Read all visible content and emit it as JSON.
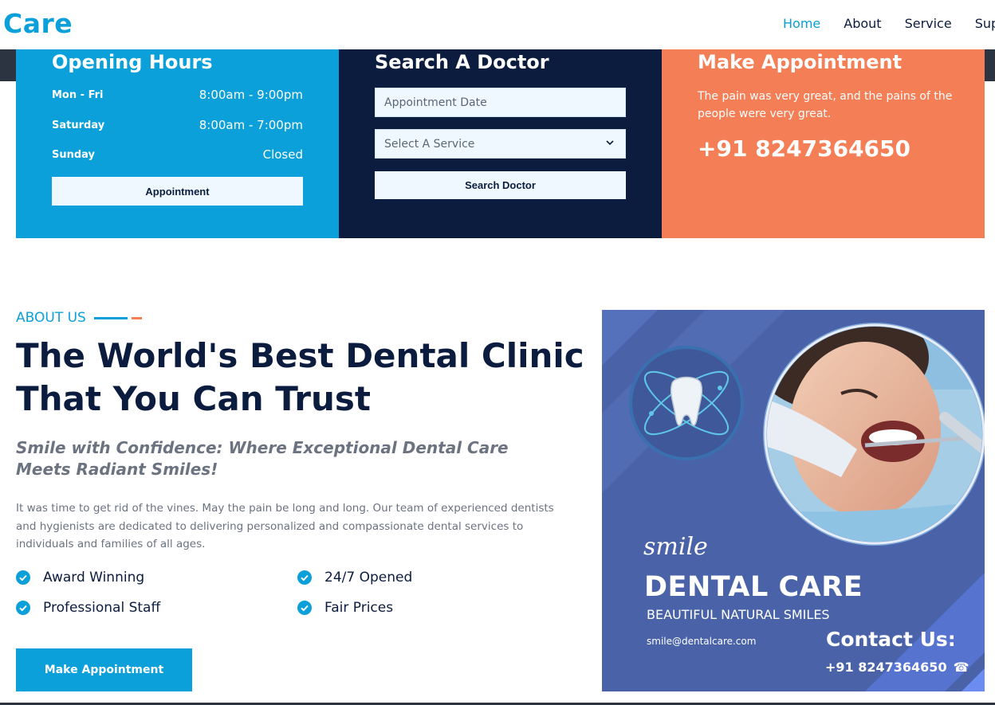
{
  "header": {
    "logo": "Care",
    "nav": [
      "Home",
      "About",
      "Service",
      "Supp"
    ]
  },
  "hours": {
    "title": "Opening Hours",
    "rows": [
      {
        "day": "Mon - Fri",
        "time": "8:00am - 9:00pm"
      },
      {
        "day": "Saturday",
        "time": "8:00am - 7:00pm"
      },
      {
        "day": "Sunday",
        "time": "Closed"
      }
    ],
    "button": "Appointment"
  },
  "search": {
    "title": "Search A Doctor",
    "date_placeholder": "Appointment Date",
    "service_select": "Select A Service",
    "button": "Search Doctor"
  },
  "appointment": {
    "title": "Make Appointment",
    "text": "The pain was very great, and the pains of the people were very great.",
    "phone": "+91 8247364650"
  },
  "about": {
    "eyebrow": "ABOUT US",
    "headline_line1": "The World's Best Dental Clinic",
    "headline_line2": "That You Can Trust",
    "tagline": "Smile with Confidence: Where Exceptional Dental Care Meets Radiant Smiles!",
    "body": "It was time to get rid of the vines. May the pain be long and long. Our team of experienced dentists and hygienists are dedicated to delivering personalized and compassionate dental services to individuals and families of all ages.",
    "features": [
      "Award Winning",
      "24/7 Opened",
      "Professional Staff",
      "Fair Prices"
    ],
    "cta": "Make Appointment"
  },
  "promo": {
    "script": "smile",
    "title": "DENTAL CARE",
    "subtitle": "BEAUTIFUL NATURAL SMILES",
    "email": "smile@dentalcare.com",
    "contact_label": "Contact Us:",
    "phone": "+91 8247364650"
  },
  "colors": {
    "primary": "#0ba0d9",
    "navy": "#0b1c3f",
    "orange": "#f47e55",
    "promo_bg": "#4a63a8"
  }
}
